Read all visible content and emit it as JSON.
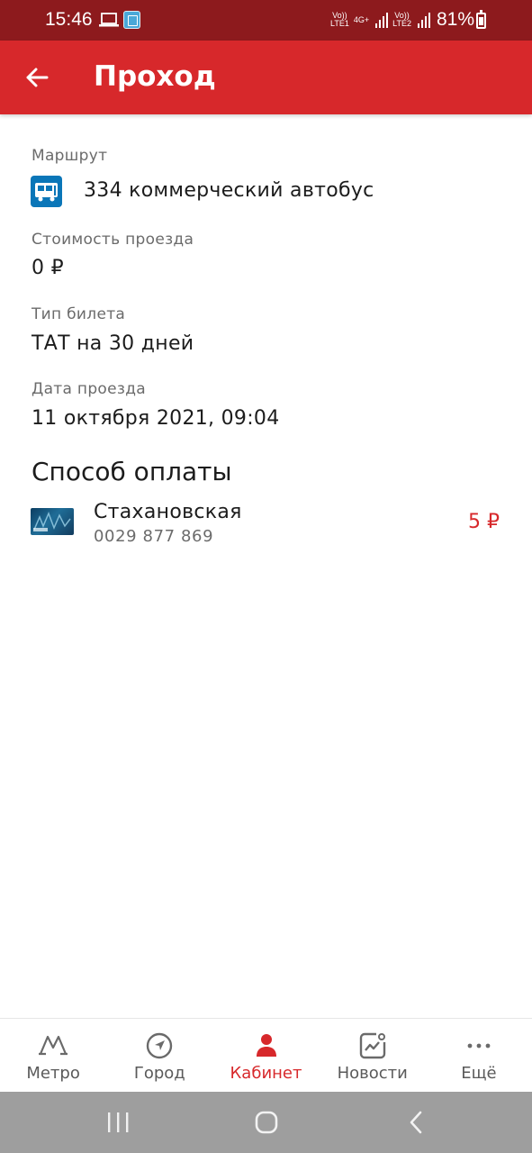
{
  "status_bar": {
    "time": "15:46",
    "network1": "Vo))\nLTE1",
    "network_type": "4G+",
    "network2": "Vo))\nLTE2",
    "battery": "81%"
  },
  "appbar": {
    "title": "Проход"
  },
  "details": {
    "route_label": "Маршрут",
    "route_value": "334 коммерческий автобус",
    "fare_label": "Стоимость проезда",
    "fare_value": "0 ₽",
    "ticket_type_label": "Тип билета",
    "ticket_type_value": "ТАТ на 30 дней",
    "date_label": "Дата проезда",
    "date_value": "11 октября 2021, 09:04"
  },
  "payment": {
    "section_title": "Способ оплаты",
    "card_name": "Стахановская",
    "card_number": "0029 877 869",
    "amount": "5 ₽"
  },
  "bottom_nav": {
    "items": [
      {
        "label": "Метро",
        "icon": "metro-icon",
        "active": false
      },
      {
        "label": "Город",
        "icon": "navigation-icon",
        "active": false
      },
      {
        "label": "Кабинет",
        "icon": "person-icon",
        "active": true
      },
      {
        "label": "Новости",
        "icon": "news-icon",
        "active": false
      },
      {
        "label": "Ещё",
        "icon": "more-icon",
        "active": false
      }
    ]
  },
  "colors": {
    "primary": "#d7282b",
    "status_bar": "#8d1a1d",
    "route_icon": "#0a76b8",
    "secondary_text": "#6b6b6b"
  }
}
